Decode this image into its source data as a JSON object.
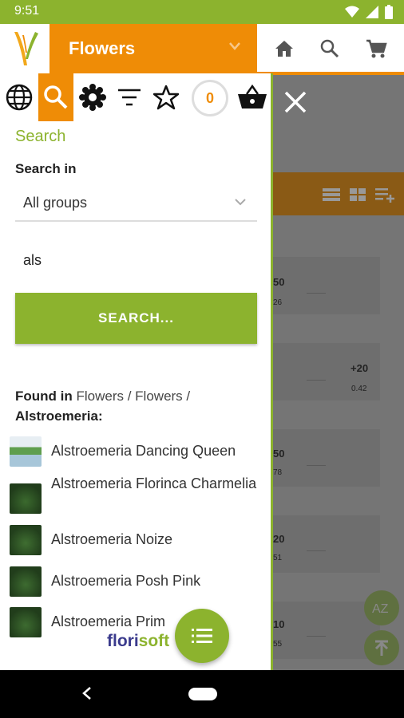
{
  "status_bar": {
    "time": "9:51"
  },
  "header": {
    "category_title": "Flowers"
  },
  "toolbar": {
    "basket_count": "0"
  },
  "search_panel": {
    "title": "Search",
    "search_in_label": "Search in",
    "group_select_value": "All groups",
    "query_value": "als",
    "search_button_label": "SEARCH..."
  },
  "results": {
    "found_in_label": "Found in",
    "found_in_path": "Flowers / Flowers /",
    "found_in_group": "Alstroemeria",
    "items": [
      {
        "name": "Alstroemeria Dancing Queen"
      },
      {
        "name": "Alstroemeria Florinca Charmelia"
      },
      {
        "name": "Alstroemeria Noize"
      },
      {
        "name": "Alstroemeria Posh Pink"
      },
      {
        "name": "Alstroemeria Prim"
      }
    ]
  },
  "background_list": {
    "rows": [
      {
        "value": "50",
        "sub": "26"
      },
      {
        "value": "+20",
        "sub": "0.42"
      },
      {
        "value": "50",
        "sub": "78"
      },
      {
        "value": "20",
        "sub": "51"
      },
      {
        "value": "10",
        "sub": "55"
      }
    ]
  },
  "branding": {
    "logo_main": "flori",
    "logo_accent": "soft"
  },
  "colors": {
    "green": "#8cb32e",
    "orange": "#ef8c06"
  }
}
